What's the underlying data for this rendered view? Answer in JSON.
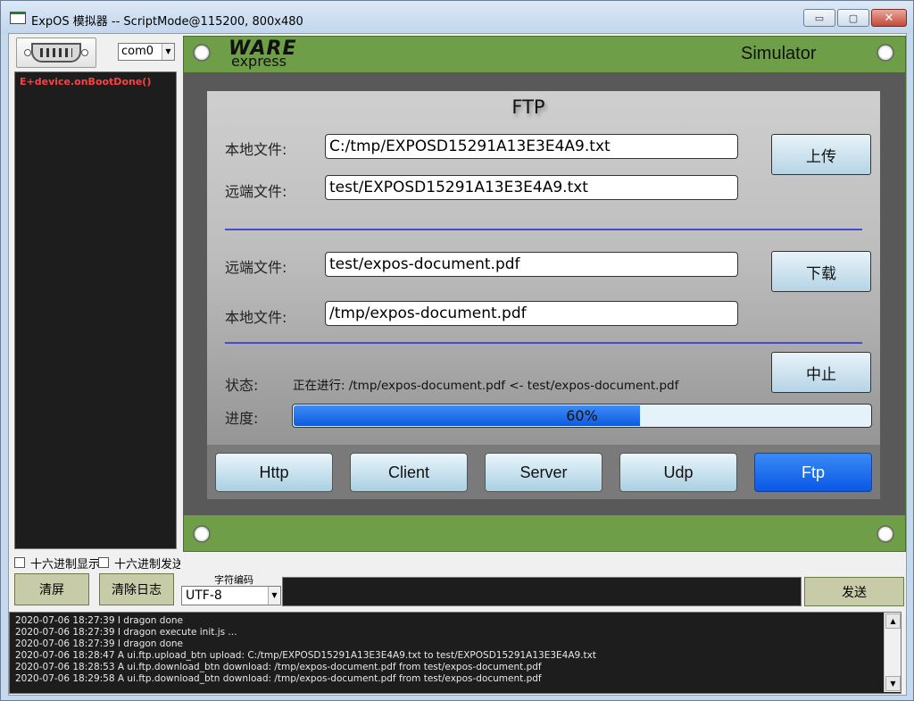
{
  "window": {
    "title": "ExpOS 模拟器 -- ScriptMode@115200, 800x480",
    "min_glyph": "▭",
    "max_glyph": "▢",
    "close_glyph": "✕"
  },
  "left": {
    "port": "com0",
    "console_lines": [
      "E+device.onBootDone()"
    ],
    "hex_display_label": "十六进制显示",
    "hex_send_label": "十六进制发送",
    "clear_screen_label": "清屏",
    "clear_log_label": "清除日志"
  },
  "bottom": {
    "encoding_label": "字符编码",
    "encoding_value": "UTF-8",
    "send_label": "发送",
    "log_lines": [
      "2020-07-06 18:27:39 I dragon done",
      "2020-07-06 18:27:39 I dragon execute init.js ...",
      "2020-07-06 18:27:39 I dragon done",
      "2020-07-06 18:28:47 A ui.ftp.upload_btn upload: C:/tmp/EXPOSD15291A13E3E4A9.txt to test/EXPOSD15291A13E3E4A9.txt",
      "2020-07-06 18:28:53 A ui.ftp.download_btn download: /tmp/expos-document.pdf from test/expos-document.pdf",
      "2020-07-06 18:29:58 A ui.ftp.download_btn download: /tmp/expos-document.pdf from test/expos-document.pdf"
    ]
  },
  "device": {
    "logo_top": "WARE",
    "logo_bottom": "express",
    "simulator_label": "Simulator",
    "ftp": {
      "title": "FTP",
      "upload": {
        "local_label": "本地文件:",
        "local_value": "C:/tmp/EXPOSD15291A13E3E4A9.txt",
        "remote_label": "远端文件:",
        "remote_value": "test/EXPOSD15291A13E3E4A9.txt",
        "button": "上传"
      },
      "download": {
        "remote_label": "远端文件:",
        "remote_value": "test/expos-document.pdf",
        "local_label": "本地文件:",
        "local_value": "/tmp/expos-document.pdf",
        "button": "下载"
      },
      "status_label": "状态:",
      "status_value": "正在进行: /tmp/expos-document.pdf <- test/expos-document.pdf",
      "stop_button": "中止",
      "progress_label": "进度:",
      "progress_percent": 60,
      "progress_text": "60%"
    },
    "tabs": [
      {
        "label": "Http",
        "active": false
      },
      {
        "label": "Client",
        "active": false
      },
      {
        "label": "Server",
        "active": false
      },
      {
        "label": "Udp",
        "active": false
      },
      {
        "label": "Ftp",
        "active": true
      }
    ]
  }
}
